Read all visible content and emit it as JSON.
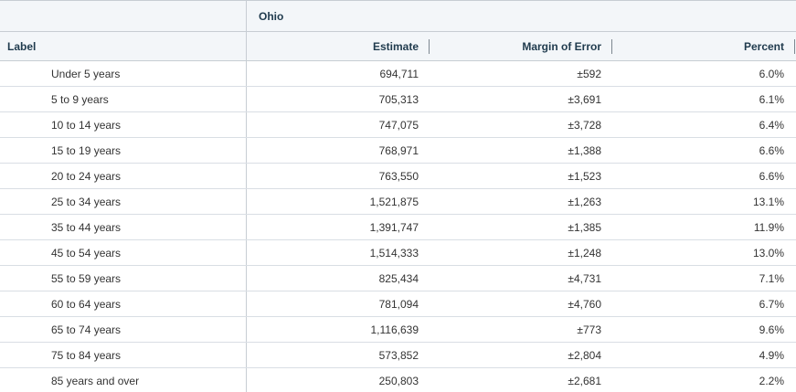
{
  "header": {
    "group": "Ohio",
    "label_col": "Label",
    "estimate_col": "Estimate",
    "moe_col": "Margin of Error",
    "percent_col": "Percent"
  },
  "rows": [
    {
      "label": "Under 5 years",
      "estimate": "694,711",
      "moe": "±592",
      "percent": "6.0%"
    },
    {
      "label": "5 to 9 years",
      "estimate": "705,313",
      "moe": "±3,691",
      "percent": "6.1%"
    },
    {
      "label": "10 to 14 years",
      "estimate": "747,075",
      "moe": "±3,728",
      "percent": "6.4%"
    },
    {
      "label": "15 to 19 years",
      "estimate": "768,971",
      "moe": "±1,388",
      "percent": "6.6%"
    },
    {
      "label": "20 to 24 years",
      "estimate": "763,550",
      "moe": "±1,523",
      "percent": "6.6%"
    },
    {
      "label": "25 to 34 years",
      "estimate": "1,521,875",
      "moe": "±1,263",
      "percent": "13.1%"
    },
    {
      "label": "35 to 44 years",
      "estimate": "1,391,747",
      "moe": "±1,385",
      "percent": "11.9%"
    },
    {
      "label": "45 to 54 years",
      "estimate": "1,514,333",
      "moe": "±1,248",
      "percent": "13.0%"
    },
    {
      "label": "55 to 59 years",
      "estimate": "825,434",
      "moe": "±4,731",
      "percent": "7.1%"
    },
    {
      "label": "60 to 64 years",
      "estimate": "781,094",
      "moe": "±4,760",
      "percent": "6.7%"
    },
    {
      "label": "65 to 74 years",
      "estimate": "1,116,639",
      "moe": "±773",
      "percent": "9.6%"
    },
    {
      "label": "75 to 84 years",
      "estimate": "573,852",
      "moe": "±2,804",
      "percent": "4.9%"
    },
    {
      "label": "85 years and over",
      "estimate": "250,803",
      "moe": "±2,681",
      "percent": "2.2%"
    }
  ]
}
